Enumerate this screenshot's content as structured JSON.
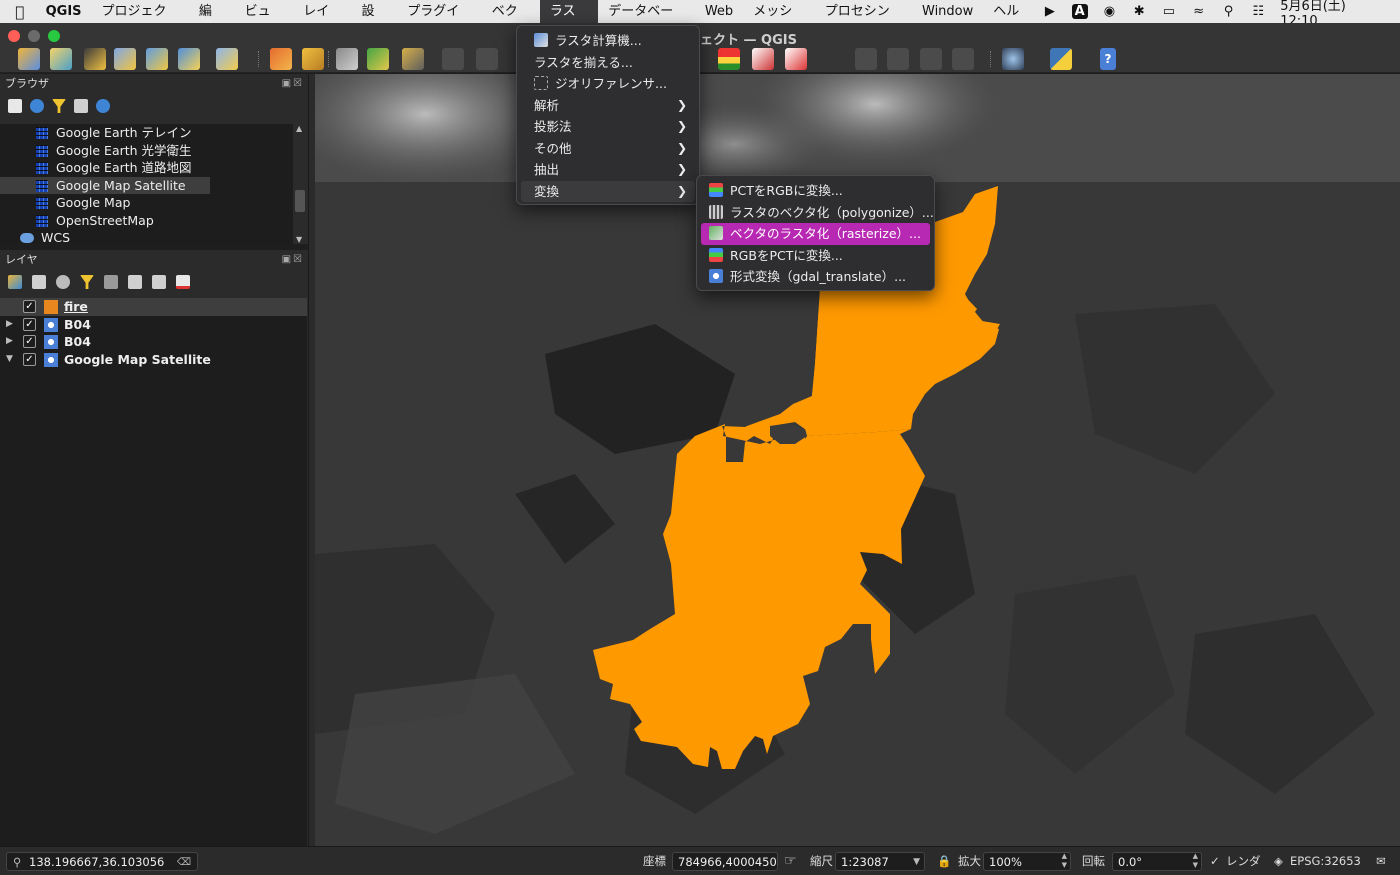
{
  "menubar": {
    "app": "QGIS",
    "items": [
      "プロジェクト",
      "編集",
      "ビュー",
      "レイヤ",
      "設定",
      "プラグイン",
      "ベクタ",
      "ラスタ",
      "データベース",
      "Web",
      "メッシュ",
      "プロセシング",
      "Window",
      "ヘルプ"
    ],
    "active_item": "ラスタ",
    "datetime": "5月6日(土)  12:10",
    "input_indicator": "A"
  },
  "window": {
    "title": "ェクト — QGIS"
  },
  "browser": {
    "title": "ブラウザ",
    "items": [
      {
        "label": "Google Earth テレイン"
      },
      {
        "label": "Google Earth 光学衛生"
      },
      {
        "label": "Google Earth 道路地図"
      },
      {
        "label": "Google Map Satellite",
        "selected": true
      },
      {
        "label": "Google Map"
      },
      {
        "label": "OpenStreetMap"
      },
      {
        "label": "WCS"
      }
    ]
  },
  "layers": {
    "title": "レイヤ",
    "items": [
      {
        "name": "fire",
        "checked": true,
        "selected": true
      },
      {
        "name": "B04",
        "checked": true
      },
      {
        "name": "B04",
        "checked": true
      },
      {
        "name": "Google Map Satellite",
        "checked": true
      }
    ]
  },
  "raster_menu": {
    "items": [
      {
        "label": "ラスタ計算機..."
      },
      {
        "label": "ラスタを揃える..."
      },
      {
        "label": "ジオリファレンサ..."
      },
      {
        "label": "解析"
      },
      {
        "label": "投影法"
      },
      {
        "label": "その他"
      },
      {
        "label": "抽出"
      },
      {
        "label": "変換"
      }
    ]
  },
  "convert_submenu": {
    "items": [
      {
        "label": "PCTをRGBに変換..."
      },
      {
        "label": "ラスタのベクタ化（polygonize）..."
      },
      {
        "label": "ベクタのラスタ化（rasterize）..."
      },
      {
        "label": "RGBをPCTに変換..."
      },
      {
        "label": "形式変換（gdal_translate）..."
      }
    ]
  },
  "statusbar": {
    "search_value": "138.196667,36.103056",
    "coord_label": "座標",
    "coord_value": "784966,4000450",
    "scale_label": "縮尺",
    "scale_value": "1:23087",
    "magnify_label": "拡大",
    "magnify_value": "100%",
    "rotation_label": "回転",
    "rotation_value": "0.0°",
    "render_label": "レンダ",
    "crs": "EPSG:32653"
  },
  "colors": {
    "fire_polygon": "#ff9900",
    "menu_highlight": "#b829b3"
  }
}
